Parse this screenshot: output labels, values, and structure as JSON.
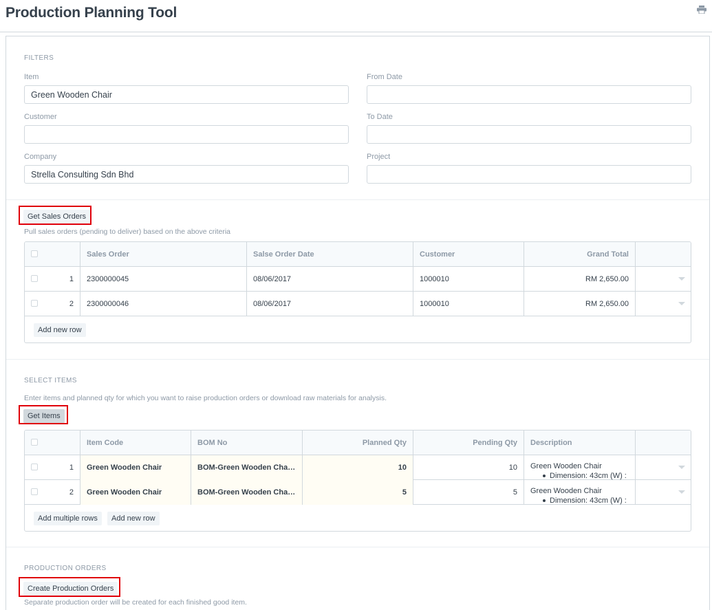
{
  "page": {
    "title": "Production Planning Tool",
    "print_icon": "print-icon"
  },
  "filters": {
    "section_label": "FILTERS",
    "item": {
      "label": "Item",
      "value": "Green Wooden Chair"
    },
    "from_date": {
      "label": "From Date",
      "value": ""
    },
    "customer": {
      "label": "Customer",
      "value": ""
    },
    "to_date": {
      "label": "To Date",
      "value": ""
    },
    "company": {
      "label": "Company",
      "value": "Strella Consulting Sdn Bhd"
    },
    "project": {
      "label": "Project",
      "value": ""
    }
  },
  "sales_orders": {
    "button_label": "Get Sales Orders",
    "help": "Pull sales orders (pending to deliver) based on the above criteria",
    "columns": [
      "Sales Order",
      "Salse Order Date",
      "Customer",
      "Grand Total"
    ],
    "rows": [
      {
        "idx": "1",
        "sales_order": "2300000045",
        "date": "08/06/2017",
        "customer": "1000010",
        "grand_total": "RM 2,650.00"
      },
      {
        "idx": "2",
        "sales_order": "2300000046",
        "date": "08/06/2017",
        "customer": "1000010",
        "grand_total": "RM 2,650.00"
      }
    ],
    "add_row_label": "Add new row"
  },
  "select_items": {
    "section_label": "SELECT ITEMS",
    "help": "Enter items and planned qty for which you want to raise production orders or download raw materials for analysis.",
    "button_label": "Get Items",
    "columns": [
      "Item Code",
      "BOM No",
      "Planned Qty",
      "Pending Qty",
      "Description"
    ],
    "rows": [
      {
        "idx": "1",
        "item_code": "Green Wooden Chair",
        "bom_no": "BOM-Green Wooden Chai...",
        "planned_qty": "10",
        "pending_qty": "10",
        "description": "Green Wooden Chair",
        "description_detail": "Dimension: 43cm (W) :"
      },
      {
        "idx": "2",
        "item_code": "Green Wooden Chair",
        "bom_no": "BOM-Green Wooden Chai...",
        "planned_qty": "5",
        "pending_qty": "5",
        "description": "Green Wooden Chair",
        "description_detail": "Dimension: 43cm (W) :"
      }
    ],
    "add_multiple_label": "Add multiple rows",
    "add_row_label": "Add new row"
  },
  "production_orders": {
    "section_label": "PRODUCTION ORDERS",
    "button_label": "Create Production Orders",
    "help": "Separate production order will be created for each finished good item."
  },
  "colors": {
    "highlight": "#e0000a",
    "text": "#36414c",
    "muted": "#8d99a6",
    "border": "#d1d8dd"
  }
}
